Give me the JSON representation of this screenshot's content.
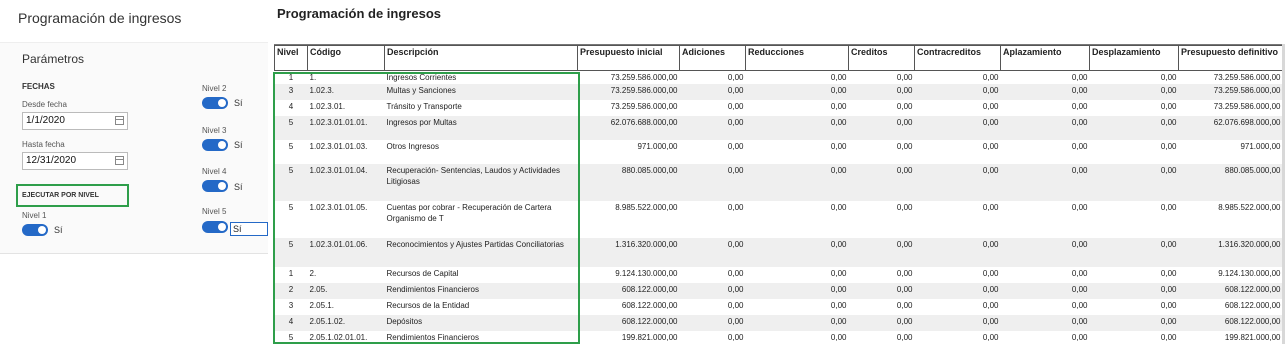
{
  "sidebar": {
    "title": "Programación de ingresos",
    "params_title": "Parámetros",
    "fechas_label": "FECHAS",
    "desde_label": "Desde fecha",
    "desde_value": "1/1/2020",
    "hasta_label": "Hasta fecha",
    "hasta_value": "12/31/2020",
    "ejecutar_label": "EJECUTAR POR NIVEL",
    "levels": [
      {
        "label": "Nivel 1",
        "value": "Sí"
      },
      {
        "label": "Nivel 2",
        "value": "Sí"
      },
      {
        "label": "Nivel 3",
        "value": "Sí"
      },
      {
        "label": "Nivel 4",
        "value": "Sí"
      },
      {
        "label": "Nivel 5",
        "value": "Sí"
      }
    ]
  },
  "main": {
    "title": "Programación de ingresos",
    "headers": [
      "Nivel",
      "Código",
      "Descripción",
      "Presupuesto inicial",
      "Adiciones",
      "Reducciones",
      "Creditos",
      "Contracreditos",
      "Aplazamiento",
      "Desplazamiento",
      "Presupuesto definitivo"
    ],
    "rows": [
      {
        "nivel": "1",
        "codigo": "1.",
        "descripcion": "Ingresos Corrientes",
        "inicial": "73.259.586.000,00",
        "adiciones": "0,00",
        "reducciones": "0,00",
        "creditos": "0,00",
        "contracreditos": "0,00",
        "aplazamiento": "0,00",
        "desplazamiento": "0,00",
        "definitivo": "73.259.586.000,00"
      },
      {
        "nivel": "3",
        "codigo": "1.02.3.",
        "descripcion": "Multas y Sanciones",
        "inicial": "73.259.586.000,00",
        "adiciones": "0,00",
        "reducciones": "0,00",
        "creditos": "0,00",
        "contracreditos": "0,00",
        "aplazamiento": "0,00",
        "desplazamiento": "0,00",
        "definitivo": "73.259.586.000,00"
      },
      {
        "nivel": "4",
        "codigo": "1.02.3.01.",
        "descripcion": "Tránsito y Transporte",
        "inicial": "73.259.586.000,00",
        "adiciones": "0,00",
        "reducciones": "0,00",
        "creditos": "0,00",
        "contracreditos": "0,00",
        "aplazamiento": "0,00",
        "desplazamiento": "0,00",
        "definitivo": "73.259.586.000,00"
      },
      {
        "nivel": "5",
        "codigo": "1.02.3.01.01.01.",
        "descripcion": "Ingresos por Multas",
        "inicial": "62.076.688.000,00",
        "adiciones": "0,00",
        "reducciones": "0,00",
        "creditos": "0,00",
        "contracreditos": "0,00",
        "aplazamiento": "0,00",
        "desplazamiento": "0,00",
        "definitivo": "62.076.698.000,00"
      },
      {
        "nivel": "5",
        "codigo": "1.02.3.01.01.03.",
        "descripcion": "Otros Ingresos",
        "inicial": "971.000,00",
        "adiciones": "0,00",
        "reducciones": "0,00",
        "creditos": "0,00",
        "contracreditos": "0,00",
        "aplazamiento": "0,00",
        "desplazamiento": "0,00",
        "definitivo": "971.000,00"
      },
      {
        "nivel": "5",
        "codigo": "1.02.3.01.01.04.",
        "descripcion": "Recuperación- Sentencias, Laudos y Actividades Litigiosas",
        "inicial": "880.085.000,00",
        "adiciones": "0,00",
        "reducciones": "0,00",
        "creditos": "0,00",
        "contracreditos": "0,00",
        "aplazamiento": "0,00",
        "desplazamiento": "0,00",
        "definitivo": "880.085.000,00"
      },
      {
        "nivel": "5",
        "codigo": "1.02.3.01.01.05.",
        "descripcion": "Cuentas por cobrar - Recuperación de Cartera Organismo de T",
        "inicial": "8.985.522.000,00",
        "adiciones": "0,00",
        "reducciones": "0,00",
        "creditos": "0,00",
        "contracreditos": "0,00",
        "aplazamiento": "0,00",
        "desplazamiento": "0,00",
        "definitivo": "8.985.522.000,00"
      },
      {
        "nivel": "5",
        "codigo": "1.02.3.01.01.06.",
        "descripcion": "Reconocimientos y Ajustes Partidas Conciliatorias",
        "inicial": "1.316.320.000,00",
        "adiciones": "0,00",
        "reducciones": "0,00",
        "creditos": "0,00",
        "contracreditos": "0,00",
        "aplazamiento": "0,00",
        "desplazamiento": "0,00",
        "definitivo": "1.316.320.000,00"
      },
      {
        "nivel": "1",
        "codigo": "2.",
        "descripcion": "Recursos de Capital",
        "inicial": "9.124.130.000,00",
        "adiciones": "0,00",
        "reducciones": "0,00",
        "creditos": "0,00",
        "contracreditos": "0,00",
        "aplazamiento": "0,00",
        "desplazamiento": "0,00",
        "definitivo": "9.124.130.000,00"
      },
      {
        "nivel": "2",
        "codigo": "2.05.",
        "descripcion": "Rendimientos Financieros",
        "inicial": "608.122.000,00",
        "adiciones": "0,00",
        "reducciones": "0,00",
        "creditos": "0,00",
        "contracreditos": "0,00",
        "aplazamiento": "0,00",
        "desplazamiento": "0,00",
        "definitivo": "608.122.000,00"
      },
      {
        "nivel": "3",
        "codigo": "2.05.1.",
        "descripcion": "Recursos de la Entidad",
        "inicial": "608.122.000,00",
        "adiciones": "0,00",
        "reducciones": "0,00",
        "creditos": "0,00",
        "contracreditos": "0,00",
        "aplazamiento": "0,00",
        "desplazamiento": "0,00",
        "definitivo": "608.122.000,00"
      },
      {
        "nivel": "4",
        "codigo": "2.05.1.02.",
        "descripcion": "Depósitos",
        "inicial": "608.122.000,00",
        "adiciones": "0,00",
        "reducciones": "0,00",
        "creditos": "0,00",
        "contracreditos": "0,00",
        "aplazamiento": "0,00",
        "desplazamiento": "0,00",
        "definitivo": "608.122.000,00"
      },
      {
        "nivel": "5",
        "codigo": "2.05.1.02.01.01.",
        "descripcion": "Rendimientos Financieros",
        "inicial": "199.821.000,00",
        "adiciones": "0,00",
        "reducciones": "0,00",
        "creditos": "0,00",
        "contracreditos": "0,00",
        "aplazamiento": "0,00",
        "desplazamiento": "0,00",
        "definitivo": "199.821.000,00"
      }
    ]
  },
  "colors": {
    "toggle_on": "#2469c7",
    "highlight": "#2e9e4a"
  }
}
